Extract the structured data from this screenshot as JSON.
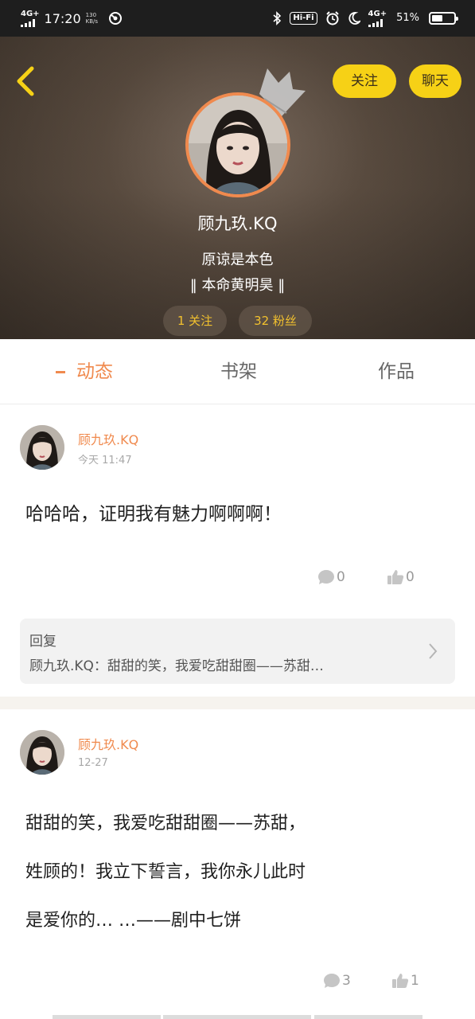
{
  "status_bar": {
    "network": "4G+",
    "time": "17:20",
    "speed": "130 KB/s",
    "hifi": "Hi-Fi",
    "network_right": "4G+",
    "battery_percent": "51%",
    "battery_level": 0.51,
    "icons": [
      "signal-icon",
      "app-notification-icon",
      "bluetooth-icon",
      "hifi-icon",
      "alarm-icon",
      "moon-icon",
      "signal-icon",
      "battery-icon"
    ]
  },
  "header": {
    "back_icon": "chevron-left-icon",
    "follow_label": "关注",
    "chat_label": "聊天",
    "crown_icon": "crown-icon",
    "nickname": "顾九玖.KQ",
    "signature_line1": "原谅是本色",
    "signature_line2": "‖ 本命黄明昊 ‖",
    "following_count": "1 关注",
    "fans_count": "32 粉丝"
  },
  "tabs": {
    "active": "动态",
    "shelf": "书架",
    "works": "作品"
  },
  "posts": [
    {
      "author": "顾九玖.KQ",
      "time": "今天 11:47",
      "body": "哈哈哈，证明我有魅力啊啊啊！",
      "comments": "0",
      "likes": "0",
      "reply": {
        "title": "回复",
        "text": "顾九玖.KQ：甜甜的笑，我爱吃甜甜圈——苏甜…"
      }
    },
    {
      "author": "顾九玖.KQ",
      "time": "12-27",
      "body_line1": "甜甜的笑，我爱吃甜甜圈——苏甜，",
      "body_line2": "姓顾的！我立下誓言，我你永儿此时",
      "body_line3": "是爱你的… …——剧中七饼",
      "comments": "3",
      "likes": "1"
    }
  ],
  "colors": {
    "accent": "#f08a4e",
    "button_yellow": "#f6d116",
    "pill_text": "#f2c12e"
  }
}
